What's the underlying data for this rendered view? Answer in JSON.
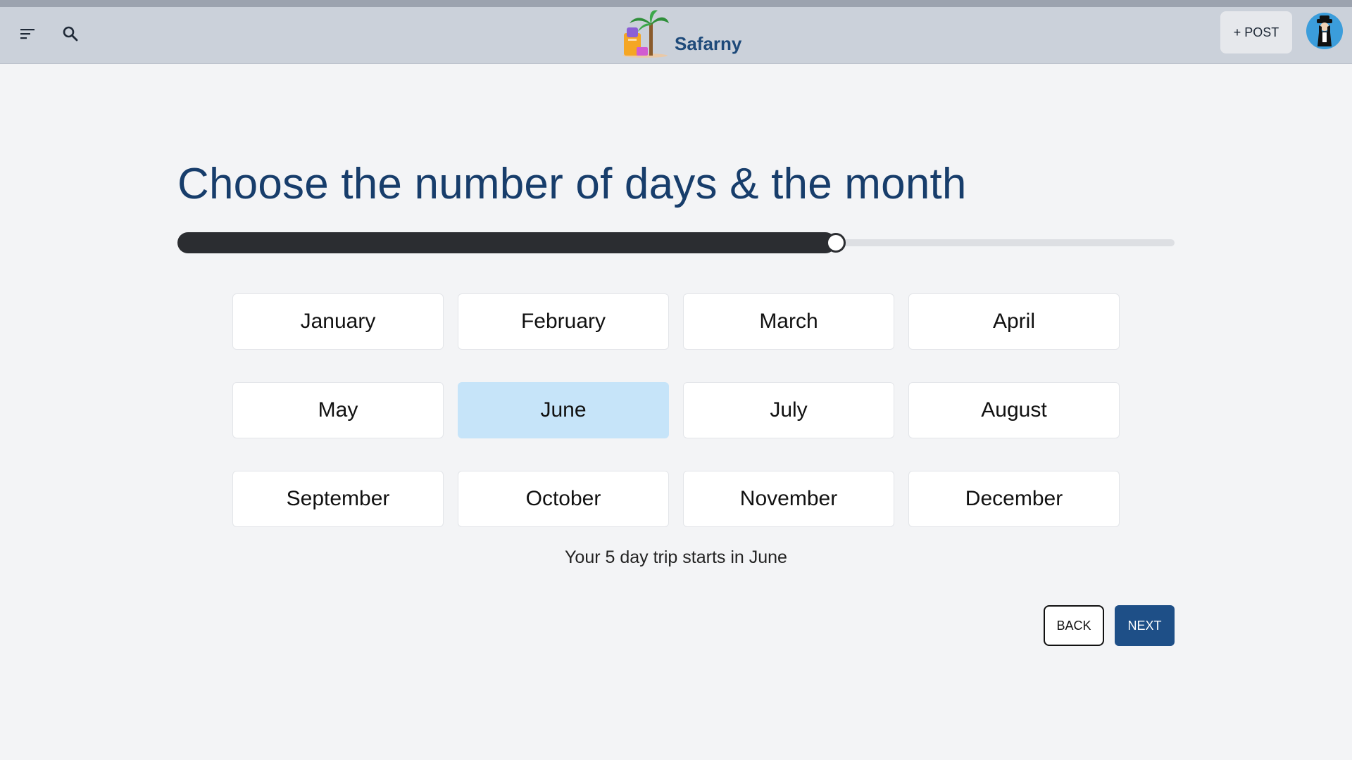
{
  "app": {
    "brand": "Safarny"
  },
  "header": {
    "post_label": "+ POST",
    "menu_icon": "menu-icon",
    "search_icon": "search-icon"
  },
  "main": {
    "title": "Choose the number of days & the month",
    "days_slider": {
      "min": 0,
      "max": 1,
      "value": 0.66
    },
    "months": [
      "January",
      "February",
      "March",
      "April",
      "May",
      "June",
      "July",
      "August",
      "September",
      "October",
      "November",
      "December"
    ],
    "selected_month": "June",
    "summary": "Your 5 day trip starts in June"
  },
  "footer": {
    "back_label": "BACK",
    "next_label": "NEXT"
  },
  "colors": {
    "accent": "#1e4f87",
    "title": "#173d6b",
    "selected": "#c6e4f9",
    "header": "#cbd1da"
  }
}
